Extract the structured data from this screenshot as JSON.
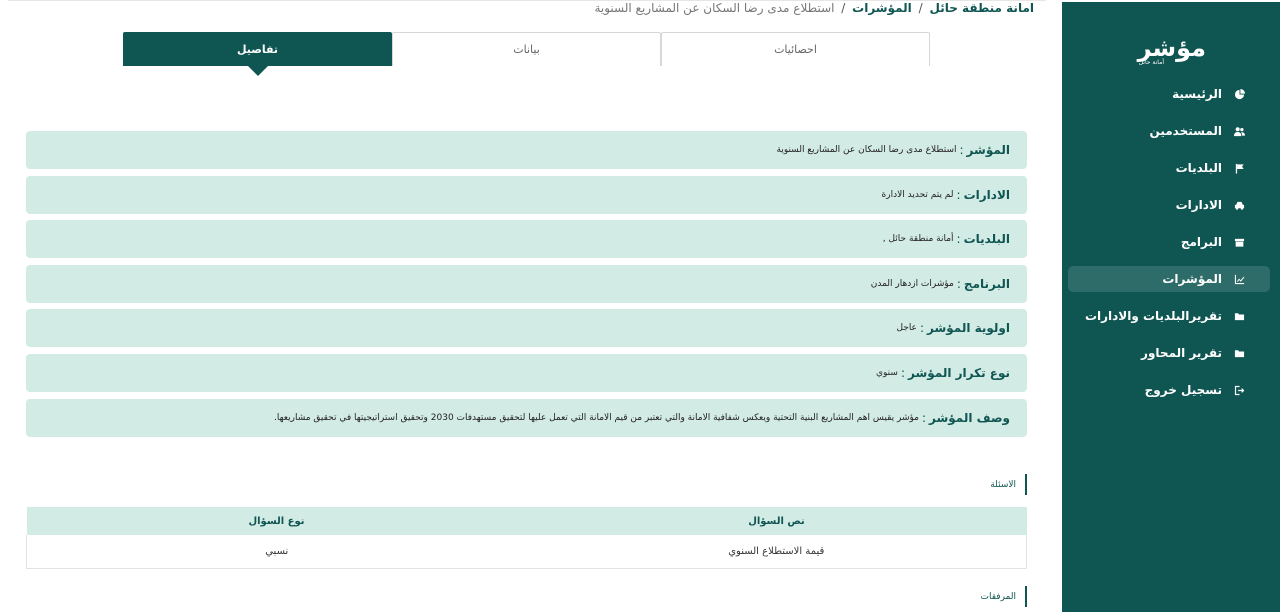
{
  "app": {
    "logo_text": "مؤشر",
    "logo_subtext": "أمانة حائل"
  },
  "sidebar": {
    "items": [
      {
        "label": "الرئيسية",
        "icon": "pie-chart-icon",
        "active": false
      },
      {
        "label": "المستخدمين",
        "icon": "users-icon",
        "active": false
      },
      {
        "label": "البلديات",
        "icon": "flag-icon",
        "active": false
      },
      {
        "label": "الادارات",
        "icon": "car-icon",
        "active": false
      },
      {
        "label": "البرامج",
        "icon": "box-icon",
        "active": false
      },
      {
        "label": "المؤشرات",
        "icon": "line-chart-icon",
        "active": true
      },
      {
        "label": "تقريرالبلديات والادارات",
        "icon": "folder-icon",
        "active": false
      },
      {
        "label": "تقرير المحاور",
        "icon": "folder-icon",
        "active": false
      },
      {
        "label": "تسجيل خروج",
        "icon": "sign-out-icon",
        "active": false
      }
    ]
  },
  "breadcrumb": {
    "root": "امانة منطقة حائل",
    "section": "المؤشرات",
    "separator": "/",
    "current": "استطلاع مدى رضا السكان عن المشاريع السنوية"
  },
  "tabs": [
    {
      "label": "تفاصيل",
      "active": true
    },
    {
      "label": "بيانات",
      "active": false
    },
    {
      "label": "احصائيات",
      "active": false
    }
  ],
  "details": [
    {
      "key": "المؤشر",
      "value": "استطلاع مدى رضا السكان عن المشاريع السنوية"
    },
    {
      "key": "الادارات",
      "value": "لم يتم تحديد الادارة"
    },
    {
      "key": "البلديات",
      "value": "أمانة منطقة حائل ,"
    },
    {
      "key": "البرنامج",
      "value": "مؤشرات ازدهار المدن"
    },
    {
      "key": "اولوية المؤشر",
      "value": "عاجل"
    },
    {
      "key": "نوع تكرار المؤشر",
      "value": "سنوي"
    },
    {
      "key": "وصف المؤشر",
      "value": "مؤشر يقيس اهم المشاريع البنية التحتية ويعكس شفافية الامانة والتي تعتبر من قيم الامانة التي تعمل عليها لتحقيق مستهدفات 2030 وتحقيق استراتيجيتها في تحقيق مشاريعها."
    }
  ],
  "questions": {
    "title": "الاسئلة",
    "headers": [
      "نص السؤال",
      "نوع السؤال"
    ],
    "rows": [
      [
        "قيمة الاستطلاع السنوي",
        "نسبي"
      ]
    ]
  },
  "attachments": {
    "title": "المرفقات"
  },
  "colors": {
    "brand": "#0f5552",
    "row_bg": "#d3ebe5",
    "active_nav": "#2e6c69"
  }
}
